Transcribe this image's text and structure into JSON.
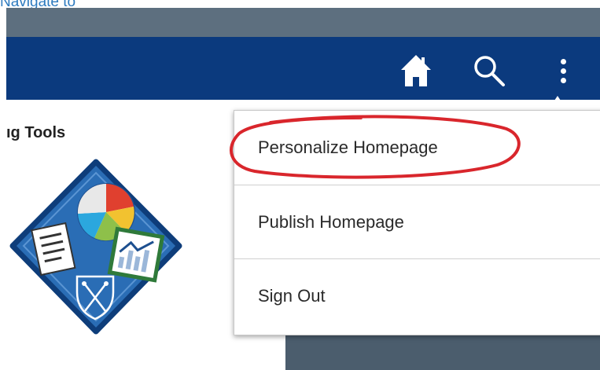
{
  "caption": "Navigate to",
  "header": {
    "icons": [
      "home-icon",
      "search-icon",
      "more-vertical-icon"
    ],
    "bg_color": "#0b3a7e"
  },
  "tile": {
    "title": "ıg Tools",
    "logo_icon": "reporting-tools-diamond-icon"
  },
  "menu": {
    "items": [
      {
        "label": "Personalize Homepage",
        "highlighted": true
      },
      {
        "label": "Publish Homepage",
        "highlighted": false
      },
      {
        "label": "Sign Out",
        "highlighted": false
      }
    ]
  },
  "annotation": {
    "shape": "hand-drawn ellipse",
    "color": "#d9262c"
  }
}
